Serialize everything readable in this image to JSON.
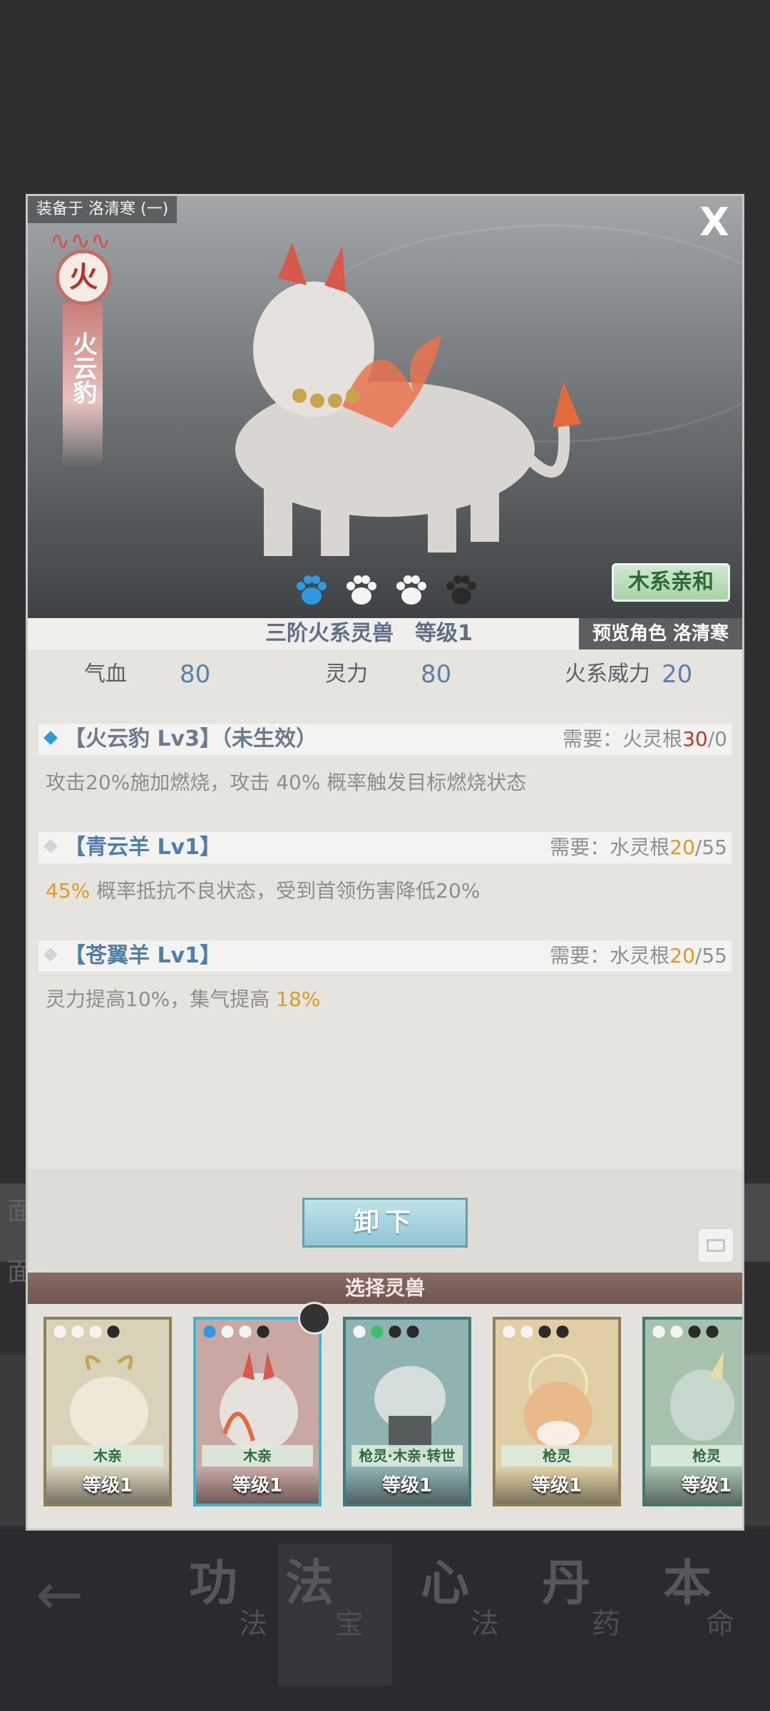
{
  "dialog": {
    "equipped_to": "装备于 洛清寒 (一)",
    "close_label": "X",
    "element": {
      "char": "火",
      "name": "火云豹",
      "color": "#c96b5e"
    },
    "affinity_badge": "木系亲和",
    "paws": {
      "filled_blue": 1,
      "white": 2,
      "dark": 1,
      "colors": {
        "blue": "#2c9be0",
        "white": "#f4f4f4",
        "dark": "#2a2a2a"
      }
    },
    "title": "三阶火系灵兽　等级1",
    "preview_role": "预览角色 洛清寒",
    "stats": [
      {
        "label": "气血",
        "value": "80"
      },
      {
        "label": "灵力",
        "value": "80"
      },
      {
        "label": "火系威力",
        "value": "20"
      }
    ],
    "skills": [
      {
        "name": "【火云豹 Lv3】（未生效）",
        "name_color": "#6b7a8c",
        "diamond_color": "#2c9be0",
        "req_prefix": "需要：火灵根",
        "req_have": "30",
        "req_have_color": "#c0392b",
        "req_sep": "/",
        "req_need": "0",
        "desc_pre": "攻击20%施加燃烧，攻击 40% 概率触发目标燃烧状态",
        "desc_highlight": "",
        "desc_post": ""
      },
      {
        "name": "【青云羊 Lv1】",
        "name_color": "#4f7fa8",
        "diamond_color": "#d4d4d4",
        "req_prefix": "需要：水灵根",
        "req_have": "20",
        "req_have_color": "#e29a1d",
        "req_sep": "/",
        "req_need": "55",
        "desc_pre": "",
        "desc_highlight": "45%",
        "desc_post": " 概率抵抗不良状态，受到首领伤害降低20%"
      },
      {
        "name": "【苍翼羊 Lv1】",
        "name_color": "#4f7fa8",
        "diamond_color": "#d4d4d4",
        "req_prefix": "需要：水灵根",
        "req_have": "20",
        "req_have_color": "#e29a1d",
        "req_sep": "/",
        "req_need": "55",
        "desc_pre": "灵力提高10%，集气提高 ",
        "desc_highlight": "18%",
        "desc_post": ""
      }
    ],
    "unequip_label": "卸下",
    "select_title": "选择灵兽",
    "cards": [
      {
        "tag": "木亲",
        "level": "等级1",
        "paws": [
          "white",
          "white",
          "white",
          "dark"
        ],
        "bg": "#d8d2b9",
        "border": "#8f7f55"
      },
      {
        "tag": "木亲",
        "level": "等级1",
        "paws": [
          "blue",
          "white",
          "white",
          "dark"
        ],
        "bg": "#c9a7a2",
        "border": "#3fb3d1"
      },
      {
        "tag": "枪灵·木亲·转世",
        "level": "等级1",
        "paws": [
          "white",
          "green",
          "dark",
          "dark"
        ],
        "bg": "#8fb3b1",
        "border": "#3f7a7a"
      },
      {
        "tag": "枪灵",
        "level": "等级1",
        "paws": [
          "white",
          "white",
          "dark",
          "dark"
        ],
        "bg": "#e0cfa4",
        "border": "#8f7f55"
      },
      {
        "tag": "枪灵",
        "level": "等级1",
        "paws": [
          "white",
          "white",
          "dark",
          "dark"
        ],
        "bg": "#a6c2ad",
        "border": "#3f7a6a"
      }
    ]
  },
  "bottom_nav": {
    "back_icon": "arrow-left-icon",
    "items": [
      {
        "big": "功",
        "small": "法"
      },
      {
        "big": "法",
        "small": "宝"
      },
      {
        "big": "心",
        "small": "法"
      },
      {
        "big": "丹",
        "small": "药"
      },
      {
        "big": "本",
        "small": "命"
      }
    ]
  },
  "background_labels": {
    "row1": "面",
    "row2": "面"
  }
}
